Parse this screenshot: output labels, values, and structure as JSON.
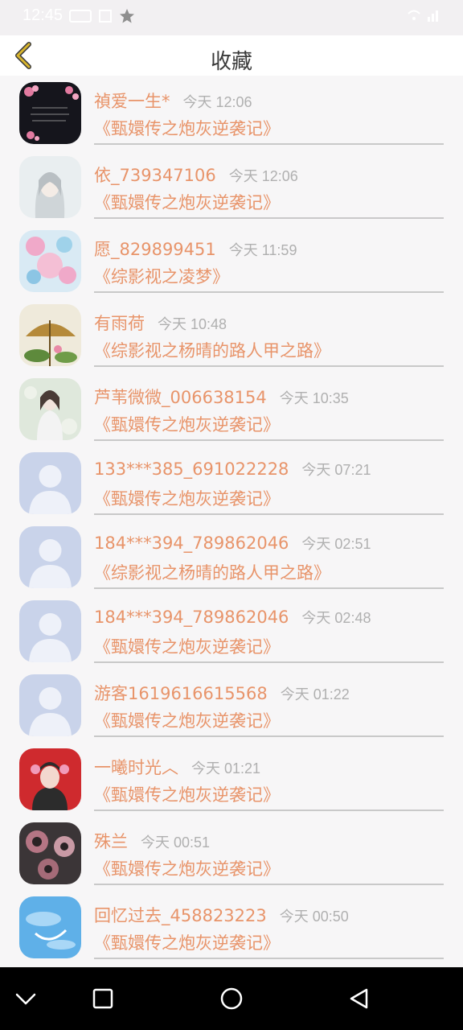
{
  "status_bar": {
    "time": "12:45",
    "icons": [
      "sim-card-icon",
      "screenshot-icon",
      "star-icon",
      "wifi-icon",
      "signal-icon"
    ]
  },
  "header": {
    "title": "收藏",
    "back_icon": "chevron-left-icon",
    "accent_color": "#d8b52e"
  },
  "items": [
    {
      "name": "禎爱一生*",
      "time": "今天 12:06",
      "title": "《甄嬛传之炮灰逆袭记》",
      "avatar": "dark-blossom"
    },
    {
      "name": "依_739347106",
      "time": "今天 12:06",
      "title": "《甄嬛传之炮灰逆袭记》",
      "avatar": "girl-sketch"
    },
    {
      "name": "愿_829899451",
      "time": "今天 11:59",
      "title": "《综影视之凌梦》",
      "avatar": "pink-fairy"
    },
    {
      "name": "有雨荷",
      "time": "今天 10:48",
      "title": "《综影视之杨晴的路人甲之路》",
      "avatar": "umbrella-lotus"
    },
    {
      "name": "芦苇微微_006638154",
      "time": "今天 10:35",
      "title": "《甄嬛传之炮灰逆袭记》",
      "avatar": "pale-girl"
    },
    {
      "name": "133***385_691022228",
      "time": "今天 07:21",
      "title": "《甄嬛传之炮灰逆袭记》",
      "avatar": "default-user"
    },
    {
      "name": "184***394_789862046",
      "time": "今天 02:51",
      "title": "《综影视之杨晴的路人甲之路》",
      "avatar": "default-user"
    },
    {
      "name": "184***394_789862046",
      "time": "今天 02:48",
      "title": "《甄嬛传之炮灰逆袭记》",
      "avatar": "default-user"
    },
    {
      "name": "游客1619616615568",
      "time": "今天 01:22",
      "title": "《甄嬛传之炮灰逆袭记》",
      "avatar": "default-user"
    },
    {
      "name": "一曦时光︿",
      "time": "今天 01:21",
      "title": "《甄嬛传之炮灰逆袭记》",
      "avatar": "red-portrait"
    },
    {
      "name": "殊兰",
      "time": "今天 00:51",
      "title": "《甄嬛传之炮灰逆袭记》",
      "avatar": "dark-flowers"
    },
    {
      "name": "回忆过去_458823223",
      "time": "今天 00:50",
      "title": "《甄嬛传之炮灰逆袭记》",
      "avatar": "blue-sky"
    }
  ],
  "colors": {
    "name_text": "#e8946a",
    "time_text": "#b0b0b0",
    "default_avatar_bg": "#c9d3ea"
  },
  "nav_bar": {
    "icons": [
      "collapse-icon",
      "recent-apps-icon",
      "home-icon",
      "back-icon"
    ]
  }
}
